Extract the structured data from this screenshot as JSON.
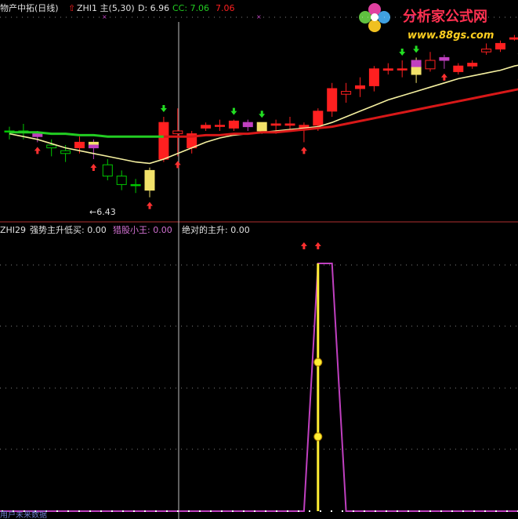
{
  "window": {
    "title_prefix": "物产中拓(日线)",
    "indicator_name": "ZHI1 主(5,30)",
    "d_label": "D: 6.96",
    "cc_label": "CC: 7.06",
    "cc_value_red": "7.06",
    "watermark_line1": "分析家公式网",
    "watermark_line2": "www.88gs.com",
    "annotation_low": "←6.43",
    "bottom_tab": "用户未来数据"
  },
  "subpanel": {
    "name": "ZHI29",
    "label1": "强势主升低买: 0.00",
    "label2": "猎股小王: 0.00",
    "label3": "绝对的主升: 0.00"
  },
  "colors": {
    "background": "#000000",
    "up_candle": "#ff2020",
    "down_candle": "#00c800",
    "magenta_candle": "#c040c0",
    "yellow_candle": "#f2e26a",
    "ma_fast": "#f5f0a0",
    "ma_slow_green": "#22cc22",
    "ma_slow_red": "#d81818",
    "sub_line_magenta": "#c040c0",
    "sub_line_yellow": "#ffee33",
    "text_white": "#e0e0e0",
    "text_magenta": "#d070d0",
    "crosshair": "#c0c0c0"
  },
  "chart_data": {
    "type": "candlestick",
    "price_range": [
      6.3,
      7.65
    ],
    "candles": [
      {
        "o": 6.9,
        "h": 6.93,
        "l": 6.84,
        "c": 6.9,
        "color": "flat_green"
      },
      {
        "o": 6.9,
        "h": 6.95,
        "l": 6.84,
        "c": 6.9,
        "color": "flat_green"
      },
      {
        "o": 6.86,
        "h": 6.9,
        "l": 6.82,
        "c": 6.88,
        "color": "magenta"
      },
      {
        "o": 6.8,
        "h": 6.84,
        "l": 6.72,
        "c": 6.78,
        "color": "green"
      },
      {
        "o": 6.76,
        "h": 6.8,
        "l": 6.68,
        "c": 6.74,
        "color": "green"
      },
      {
        "o": 6.82,
        "h": 6.86,
        "l": 6.74,
        "c": 6.78,
        "color": "red"
      },
      {
        "o": 6.78,
        "h": 6.84,
        "l": 6.7,
        "c": 6.82,
        "color": "magenta_yellow"
      },
      {
        "o": 6.66,
        "h": 6.7,
        "l": 6.55,
        "c": 6.58,
        "color": "green"
      },
      {
        "o": 6.58,
        "h": 6.62,
        "l": 6.48,
        "c": 6.52,
        "color": "green"
      },
      {
        "o": 6.52,
        "h": 6.56,
        "l": 6.46,
        "c": 6.52,
        "color": "flat_green"
      },
      {
        "o": 6.48,
        "h": 6.64,
        "l": 6.43,
        "c": 6.62,
        "color": "yellow"
      },
      {
        "o": 6.7,
        "h": 7.0,
        "l": 6.68,
        "c": 6.96,
        "color": "red"
      },
      {
        "o": 6.88,
        "h": 7.06,
        "l": 6.72,
        "c": 6.9,
        "color": "red_hollow"
      },
      {
        "o": 6.78,
        "h": 6.9,
        "l": 6.74,
        "c": 6.88,
        "color": "red"
      },
      {
        "o": 6.92,
        "h": 6.96,
        "l": 6.9,
        "c": 6.94,
        "color": "red"
      },
      {
        "o": 6.94,
        "h": 6.98,
        "l": 6.9,
        "c": 6.94,
        "color": "flat_red"
      },
      {
        "o": 6.92,
        "h": 6.98,
        "l": 6.9,
        "c": 6.97,
        "color": "red"
      },
      {
        "o": 6.93,
        "h": 6.98,
        "l": 6.9,
        "c": 6.96,
        "color": "magenta"
      },
      {
        "o": 6.96,
        "h": 6.96,
        "l": 6.88,
        "c": 6.9,
        "color": "yellow"
      },
      {
        "o": 6.94,
        "h": 6.98,
        "l": 6.88,
        "c": 6.95,
        "color": "flat_red"
      },
      {
        "o": 6.94,
        "h": 7.0,
        "l": 6.9,
        "c": 6.95,
        "color": "flat_red"
      },
      {
        "o": 6.94,
        "h": 6.96,
        "l": 6.82,
        "c": 6.92,
        "color": "red"
      },
      {
        "o": 6.94,
        "h": 7.06,
        "l": 6.9,
        "c": 7.04,
        "color": "red"
      },
      {
        "o": 7.04,
        "h": 7.24,
        "l": 7.0,
        "c": 7.2,
        "color": "red"
      },
      {
        "o": 7.16,
        "h": 7.24,
        "l": 7.1,
        "c": 7.18,
        "color": "red_hollow"
      },
      {
        "o": 7.2,
        "h": 7.28,
        "l": 7.14,
        "c": 7.22,
        "color": "flat_red"
      },
      {
        "o": 7.22,
        "h": 7.36,
        "l": 7.18,
        "c": 7.34,
        "color": "red"
      },
      {
        "o": 7.33,
        "h": 7.38,
        "l": 7.3,
        "c": 7.34,
        "color": "flat_red"
      },
      {
        "o": 7.34,
        "h": 7.4,
        "l": 7.28,
        "c": 7.34,
        "color": "flat_red"
      },
      {
        "o": 7.3,
        "h": 7.42,
        "l": 7.24,
        "c": 7.4,
        "color": "yellow_magenta"
      },
      {
        "o": 7.4,
        "h": 7.46,
        "l": 7.32,
        "c": 7.34,
        "color": "red_hollow"
      },
      {
        "o": 7.4,
        "h": 7.44,
        "l": 7.34,
        "c": 7.42,
        "color": "magenta"
      },
      {
        "o": 7.32,
        "h": 7.38,
        "l": 7.3,
        "c": 7.36,
        "color": "red"
      },
      {
        "o": 7.36,
        "h": 7.4,
        "l": 7.34,
        "c": 7.38,
        "color": "flat_red"
      },
      {
        "o": 7.46,
        "h": 7.52,
        "l": 7.44,
        "c": 7.48,
        "color": "red_hollow"
      },
      {
        "o": 7.48,
        "h": 7.54,
        "l": 7.46,
        "c": 7.52,
        "color": "red"
      },
      {
        "o": 7.56,
        "h": 7.58,
        "l": 7.54,
        "c": 7.55,
        "color": "flat_red"
      },
      {
        "o": 7.56,
        "h": 7.58,
        "l": 7.54,
        "c": 7.56,
        "color": "flat_red"
      },
      {
        "o": 7.56,
        "h": 7.58,
        "l": 7.54,
        "c": 7.55,
        "color": "flat_red"
      }
    ],
    "ma_fast": [
      6.88,
      6.86,
      6.84,
      6.81,
      6.78,
      6.76,
      6.74,
      6.72,
      6.7,
      6.68,
      6.67,
      6.7,
      6.74,
      6.78,
      6.82,
      6.85,
      6.87,
      6.88,
      6.89,
      6.9,
      6.91,
      6.92,
      6.93,
      6.96,
      7.0,
      7.04,
      7.08,
      7.12,
      7.15,
      7.18,
      7.21,
      7.24,
      7.27,
      7.29,
      7.31,
      7.33,
      7.36,
      7.38,
      7.4
    ],
    "ma_slow": [
      6.89,
      6.89,
      6.89,
      6.88,
      6.88,
      6.87,
      6.87,
      6.86,
      6.86,
      6.86,
      6.86,
      6.86,
      6.86,
      6.86,
      6.87,
      6.87,
      6.88,
      6.88,
      6.89,
      6.89,
      6.9,
      6.91,
      6.92,
      6.93,
      6.95,
      6.97,
      6.99,
      7.01,
      7.03,
      7.05,
      7.07,
      7.09,
      7.11,
      7.13,
      7.15,
      7.17,
      7.19,
      7.21,
      7.23
    ],
    "ma_slow_green_until": 11,
    "up_arrows": [
      2,
      6,
      10,
      12,
      21,
      31
    ],
    "down_arrows": [
      11,
      16,
      18,
      28,
      29
    ],
    "sub_signal": {
      "magenta_line": [
        0,
        0,
        0,
        0,
        0,
        0,
        0,
        0,
        0,
        0,
        0,
        0,
        0,
        0,
        0,
        0,
        0,
        0,
        0,
        0,
        0,
        0,
        1,
        1,
        0,
        0,
        0,
        0,
        0,
        0,
        0,
        0,
        0,
        0,
        0,
        0,
        0,
        0,
        0
      ],
      "yellow_bar_index": 22,
      "up_arrows": [
        21,
        22
      ]
    }
  }
}
